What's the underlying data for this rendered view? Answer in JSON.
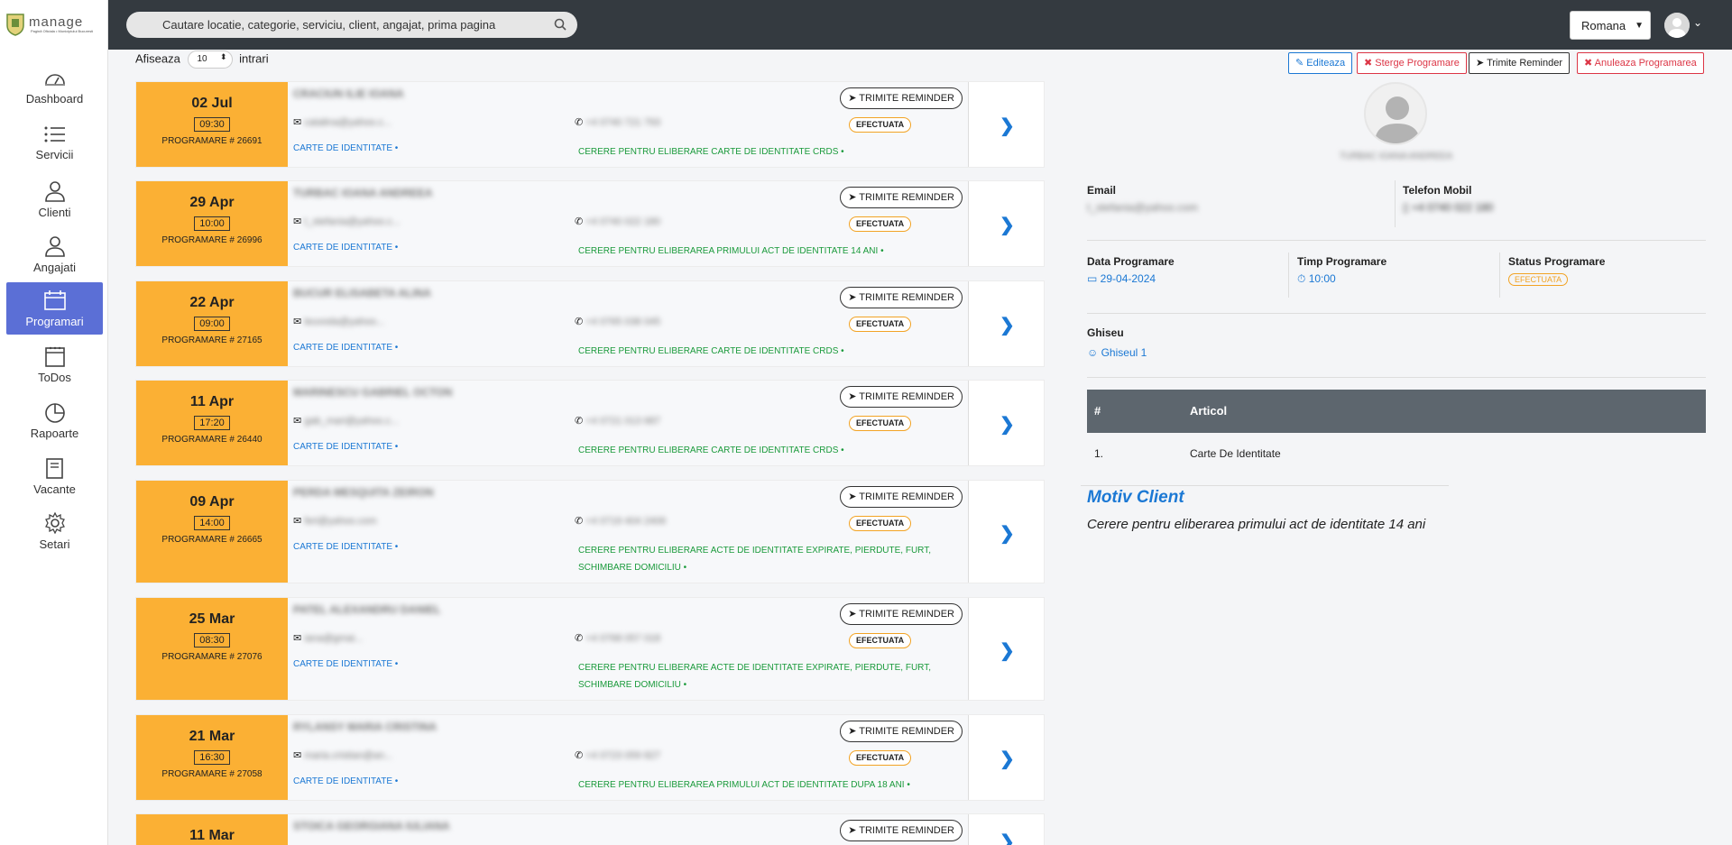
{
  "sidebar": {
    "logo_text": "manage",
    "logo_sub": "Pagină Oficiala • Municipiului Bucuresti",
    "items": [
      {
        "label": "Dashboard"
      },
      {
        "label": "Servicii"
      },
      {
        "label": "Clienti"
      },
      {
        "label": "Angajati"
      },
      {
        "label": "Programari"
      },
      {
        "label": "ToDos"
      },
      {
        "label": "Rapoarte"
      },
      {
        "label": "Vacante"
      },
      {
        "label": "Setari"
      }
    ]
  },
  "topbar": {
    "search_placeholder": "Cautare locatie, categorie, serviciu, client, angajat, prima pagina",
    "language": "Romana"
  },
  "list": {
    "show_label": "Afiseaza",
    "entries": "10",
    "entries_label": "intrari",
    "reminder_label": "TRIMITE REMINDER",
    "cards": [
      {
        "date": "02 Jul",
        "time": "09:30",
        "code": "PROGRAMARE # 26691",
        "name": "CRACIUN ILIE IOANA",
        "email": "catalina@yahoo.c...",
        "phone": "+4 0740 721 793",
        "status": "EFECTUATA",
        "service": "CARTE DE IDENTITATE •",
        "reason": "CERERE PENTRU ELIBERARE CARTE DE IDENTITATE CRDS •"
      },
      {
        "date": "29 Apr",
        "time": "10:00",
        "code": "PROGRAMARE # 26996",
        "name": "TURBAC IOANA ANDREEA",
        "email": "t_stefania@yahoo.c...",
        "phone": "+4 0740 022 180",
        "status": "EFECTUATA",
        "service": "CARTE DE IDENTITATE •",
        "reason": "CERERE PENTRU ELIBERAREA PRIMULUI ACT DE IDENTITATE 14 ANI •"
      },
      {
        "date": "22 Apr",
        "time": "09:00",
        "code": "PROGRAMARE # 27165",
        "name": "BUCUR ELISABETA ALINA",
        "email": "leuvoda@yahoo...",
        "phone": "+4 0765 038 045",
        "status": "EFECTUATA",
        "service": "CARTE DE IDENTITATE •",
        "reason": "CERERE PENTRU ELIBERARE CARTE DE IDENTITATE CRDS •"
      },
      {
        "date": "11 Apr",
        "time": "17:20",
        "code": "PROGRAMARE # 26440",
        "name": "MARINESCU GABRIEL OCTON",
        "email": "gab_mari@yahoo.c...",
        "phone": "+4 0721 013 687",
        "status": "EFECTUATA",
        "service": "CARTE DE IDENTITATE •",
        "reason": "CERERE PENTRU ELIBERARE CARTE DE IDENTITATE CRDS •"
      },
      {
        "date": "09 Apr",
        "time": "14:00",
        "code": "PROGRAMARE # 26665",
        "name": "PERDA MESQUITA ZEIRON",
        "email": "feri@yahoo.com",
        "phone": "+4 0719 404 2406",
        "status": "EFECTUATA",
        "service": "CARTE DE IDENTITATE •",
        "reason": "CERERE PENTRU ELIBERARE ACTE DE IDENTITATE EXPIRATE, PIERDUTE, FURT, SCHIMBARE DOMICILIU •"
      },
      {
        "date": "25 Mar",
        "time": "08:30",
        "code": "PROGRAMARE # 27076",
        "name": "PATEL ALEXANDRU DANIEL",
        "email": "iana@gmai...",
        "phone": "+4 0768 057 018",
        "status": "EFECTUATA",
        "service": "CARTE DE IDENTITATE •",
        "reason": "CERERE PENTRU ELIBERARE ACTE DE IDENTITATE EXPIRATE, PIERDUTE, FURT, SCHIMBARE DOMICILIU •"
      },
      {
        "date": "21 Mar",
        "time": "16:30",
        "code": "PROGRAMARE # 27058",
        "name": "RYLANSY MARIA CRISTINA",
        "email": "maria.cristian@an...",
        "phone": "+4 0723 059 827",
        "status": "EFECTUATA",
        "service": "CARTE DE IDENTITATE •",
        "reason": "CERERE PENTRU ELIBERAREA PRIMULUI ACT DE IDENTITATE DUPA 18 ANI •"
      },
      {
        "date": "11 Mar",
        "time": "",
        "code": "",
        "name": "STOICA GEORGIANA IULIANA",
        "email": "",
        "phone": "",
        "status": "",
        "service": "",
        "reason": ""
      }
    ]
  },
  "detail": {
    "actions": {
      "edit": "Editeaza",
      "delete": "Sterge Programare",
      "reminder": "Trimite Reminder",
      "cancel": "Anuleaza Programarea"
    },
    "client_name": "TURBAC IOANA ANDREEA",
    "email_label": "Email",
    "email_value": "t_stefania@yahoo.com",
    "phone_label": "Telefon Mobil",
    "phone_value": "+4 0740 022 180",
    "date_label": "Data Programare",
    "date_value": "29-04-2024",
    "time_label": "Timp Programare",
    "time_value": "10:00",
    "status_label": "Status Programare",
    "status_value": "EFECTUATA",
    "counter_label": "Ghiseu",
    "counter_value": "Ghiseul 1",
    "table_headers": [
      "#",
      "Articol"
    ],
    "table_rows": [
      {
        "num": "1.",
        "article": "Carte De Identitate"
      }
    ],
    "motiv_title": "Motiv Client",
    "motiv_text": "Cerere pentru eliberarea primului act de identitate 14 ani"
  },
  "colors": {
    "accent": "#1b78d4",
    "date_bg": "#fbb034",
    "topbar": "#343a40",
    "active_nav": "#5b6fd6",
    "danger": "#dc3545"
  }
}
